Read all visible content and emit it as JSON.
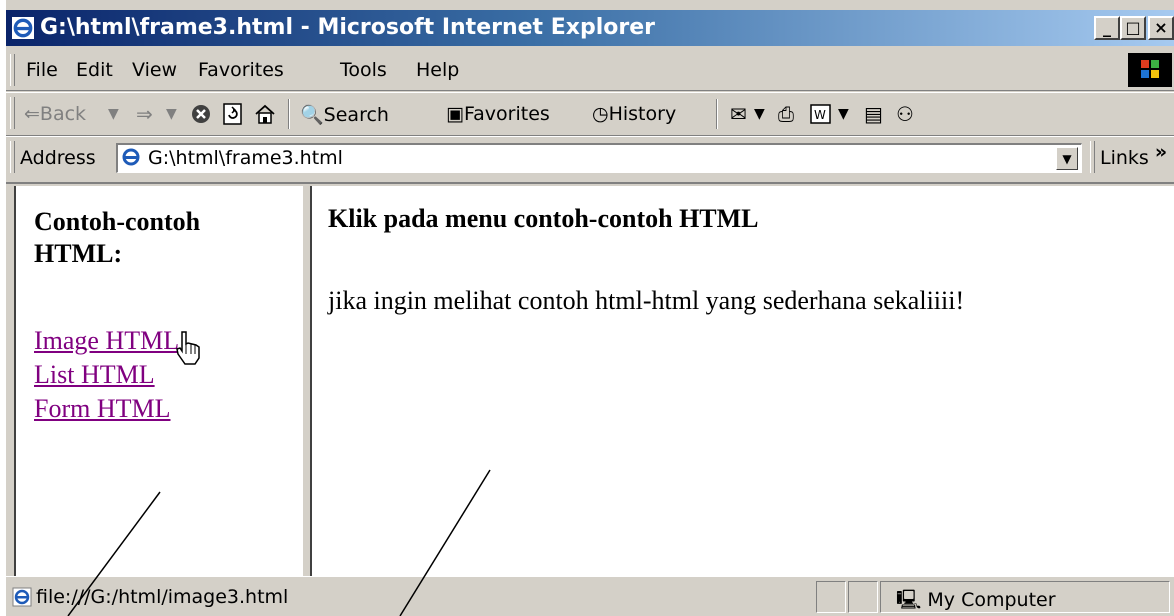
{
  "window": {
    "title": "G:\\html\\frame3.html - Microsoft Internet Explorer",
    "buttons": [
      "_",
      "□",
      "×"
    ]
  },
  "menubar": {
    "items": [
      "File",
      "Edit",
      "View",
      "Favorites",
      "Tools",
      "Help"
    ]
  },
  "toolbar": {
    "back_label": "Back",
    "search_label": "Search",
    "favorites_label": "Favorites",
    "history_label": "History"
  },
  "addressbar": {
    "label": "Address",
    "url": "G:\\html\\frame3.html",
    "links_label": "Links",
    "chevron": "»"
  },
  "left_frame": {
    "heading": "Contoh-contoh HTML:",
    "links": [
      "Image HTML",
      "List HTML",
      "Form HTML"
    ],
    "link_color": "#800080"
  },
  "right_frame": {
    "heading": "Klik pada menu contoh-contoh HTML",
    "text": "jika ingin melihat contoh html-html yang sederhana sekaliiii!"
  },
  "statusbar": {
    "text": "file:///G:/html/image3.html",
    "zone": "My Computer"
  }
}
